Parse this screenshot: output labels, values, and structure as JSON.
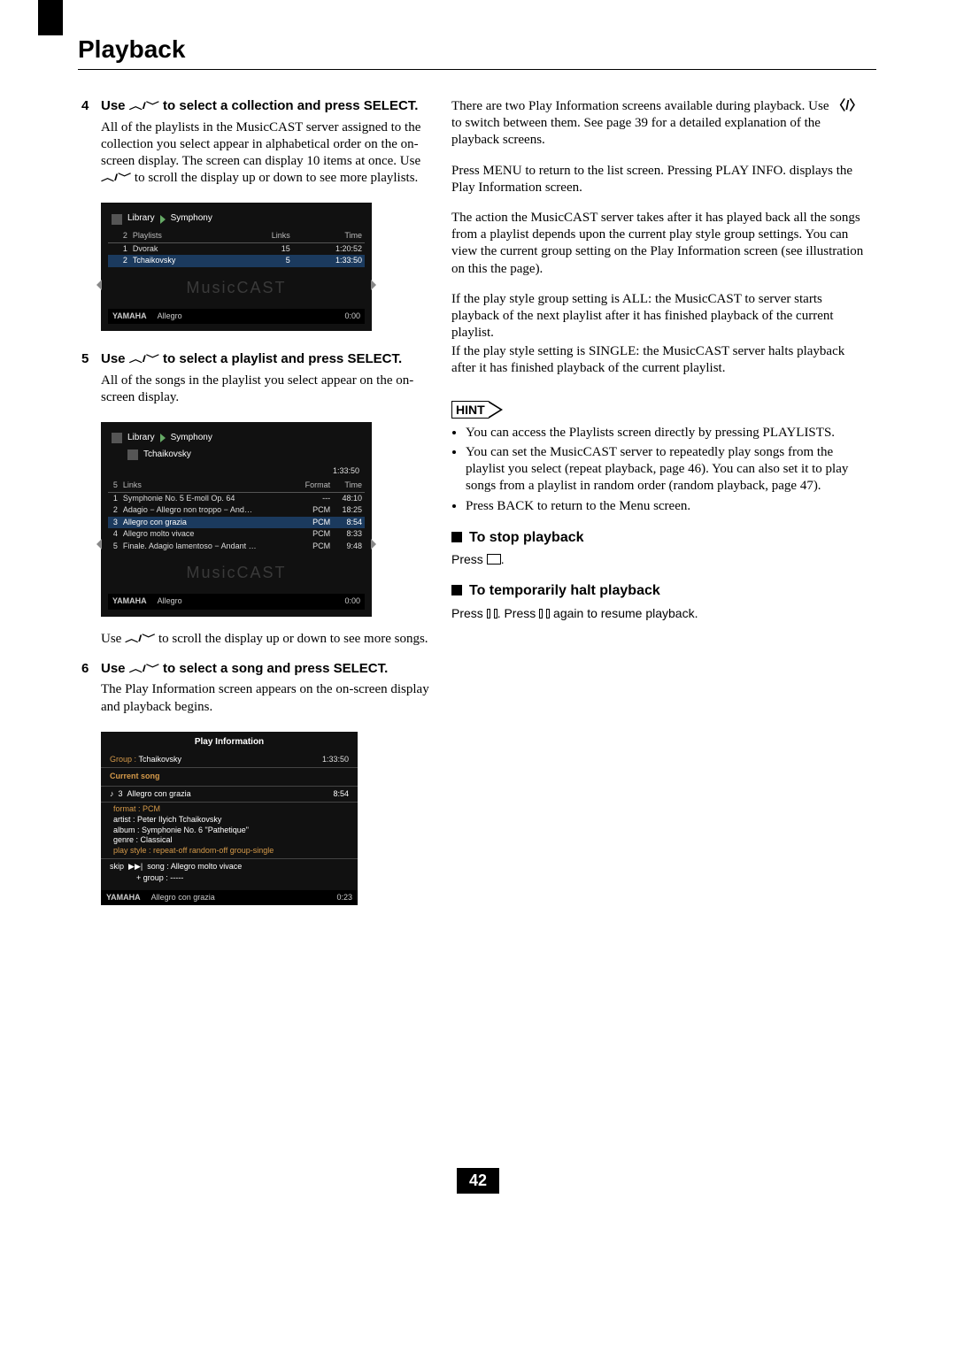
{
  "page_title": "Playback",
  "page_number": "42",
  "steps": {
    "s4": {
      "num": "4",
      "title_a": "Use ",
      "title_b": " to select a collection and press SELECT.",
      "body": "All of the playlists in the MusicCAST server assigned to the collection you select appear in alphabetical order on the on-screen display. The screen can display 10 items at once. Use ",
      "body_tail": " to scroll the display up or down to see more playlists."
    },
    "s5": {
      "num": "5",
      "title_a": "Use ",
      "title_b": " to select a playlist and press SELECT.",
      "body": "All of the songs in the playlist you select appear on the on-screen display.",
      "tail_a": "Use ",
      "tail_b": " to scroll the display up or down to see more songs."
    },
    "s6": {
      "num": "6",
      "title_a": "Use ",
      "title_b": " to select a song and press SELECT.",
      "body": "The Play Information screen appears on the on-screen display and playback begins."
    }
  },
  "shot1": {
    "crumb1": "Library",
    "crumb2": "Symphony",
    "hdr_count": "2",
    "hdr_name": "Playlists",
    "hdr_links": "Links",
    "hdr_time": "Time",
    "rows": [
      {
        "n": "1",
        "name": "Dvorak",
        "links": "15",
        "time": "1:20:52"
      },
      {
        "n": "2",
        "name": "Tchaikovsky",
        "links": "5",
        "time": "1:33:50"
      }
    ],
    "ghost": "MusicCAST",
    "status_brand": "YAMAHA",
    "status_track": "Allegro",
    "status_time": "0:00"
  },
  "shot2": {
    "crumb1": "Library",
    "crumb2": "Symphony",
    "crumb3": "Tchaikovsky",
    "total_time": "1:33:50",
    "hdr_count": "5",
    "hdr_name": "Links",
    "hdr_format": "Format",
    "hdr_time": "Time",
    "rows": [
      {
        "n": "1",
        "name": "Symphonie No. 5 E-moll Op. 64",
        "fmt": "---",
        "time": "48:10"
      },
      {
        "n": "2",
        "name": "Adagio − Allegro non troppo − And…",
        "fmt": "PCM",
        "time": "18:25"
      },
      {
        "n": "3",
        "name": "Allegro con grazia",
        "fmt": "PCM",
        "time": "8:54"
      },
      {
        "n": "4",
        "name": "Allegro molto vivace",
        "fmt": "PCM",
        "time": "8:33"
      },
      {
        "n": "5",
        "name": "Finale. Adagio lamentoso − Andant …",
        "fmt": "PCM",
        "time": "9:48"
      }
    ],
    "ghost": "MusicCAST",
    "status_brand": "YAMAHA",
    "status_track": "Allegro",
    "status_time": "0:00"
  },
  "playinfo": {
    "title": "Play Information",
    "group_label": "Group :",
    "group_value": "Tchaikovsky",
    "total": "1:33:50",
    "current_label": "Current song",
    "track_num": "3",
    "track_name": "Allegro con grazia",
    "track_time": "8:54",
    "format": "format : PCM",
    "artist": "artist : Peter Ilyich Tchaikovsky",
    "album": "album : Symphonie No. 6 \"Pathetique\"",
    "genre": "genre : Classical",
    "playstyle": "play style : repeat-off    random-off    group-single",
    "skip_label": "skip",
    "skip_song": "song : Allegro molto vivace",
    "skip_group": "group : -----",
    "status_brand": "YAMAHA",
    "status_track": "Allegro con grazia",
    "status_time": "0:23"
  },
  "right": {
    "p1a": "There are two Play Information screens available during playback. Use ",
    "p1b": " to switch between them. See page 39 for a detailed explanation of the playback screens.",
    "p2": "Press MENU to return to the list screen. Pressing PLAY INFO. displays the Play Information screen.",
    "p3": "The action the MusicCAST server takes after it has played back all the songs from a playlist depends upon the current play style group settings. You can view the current group setting on the Play Information screen (see illustration on this the page).",
    "p4": "If the play style group setting is ALL: the MusicCAST to server starts playback of the next playlist after it has finished playback of the current playlist.",
    "p5": "If the play style setting is SINGLE: the MusicCAST server halts playback after it has finished playback of the current playlist.",
    "hint_label": "HINT",
    "hint1": "You can access the Playlists screen directly by pressing PLAYLISTS.",
    "hint2": "You can set the MusicCAST server to repeatedly play songs from the playlist you select (repeat playback, page 46). You can also set it to play songs from a playlist in random order (random playback, page 47).",
    "hint3": "Press BACK to return to the Menu screen.",
    "stop_head": "To stop playback",
    "stop_body_a": "Press ",
    "stop_body_b": ".",
    "pause_head": "To temporarily halt playback",
    "pause_body_a": "Press ",
    "pause_body_b": ". Press ",
    "pause_body_c": " again to resume playback."
  }
}
